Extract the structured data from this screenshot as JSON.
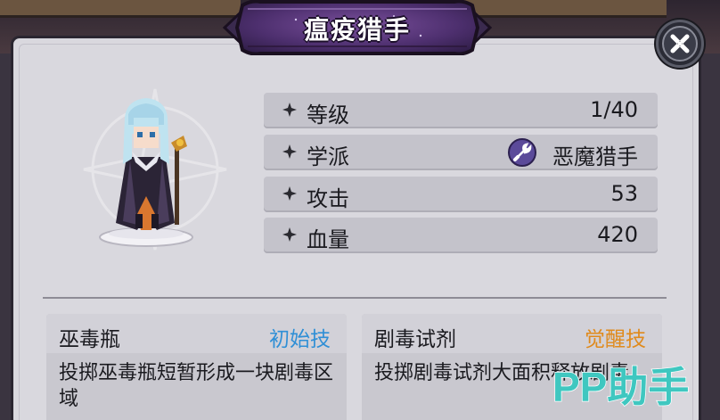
{
  "title": "瘟疫猎手",
  "stats": [
    {
      "label": "等级",
      "value": "1/40"
    },
    {
      "label": "学派",
      "value": "恶魔猎手"
    },
    {
      "label": "攻击",
      "value": "53"
    },
    {
      "label": "血量",
      "value": "420"
    }
  ],
  "skills": [
    {
      "name": "巫毒瓶",
      "tag": "初始技",
      "tag_color": "#2f8fd6",
      "description": "投掷巫毒瓶短暂形成一块剧毒区域"
    },
    {
      "name": "剧毒试剂",
      "tag": "觉醒技",
      "tag_color": "#e08a1c",
      "description": "投掷剧毒试剂大面积释放剧毒"
    }
  ],
  "watermark": {
    "text": "PP助手",
    "color": "#3fc7c0"
  },
  "icons": {
    "close": "close-x-icon",
    "stat_bullet": "four-point-star-icon",
    "school": "demon-hunter-wrench-icon"
  }
}
